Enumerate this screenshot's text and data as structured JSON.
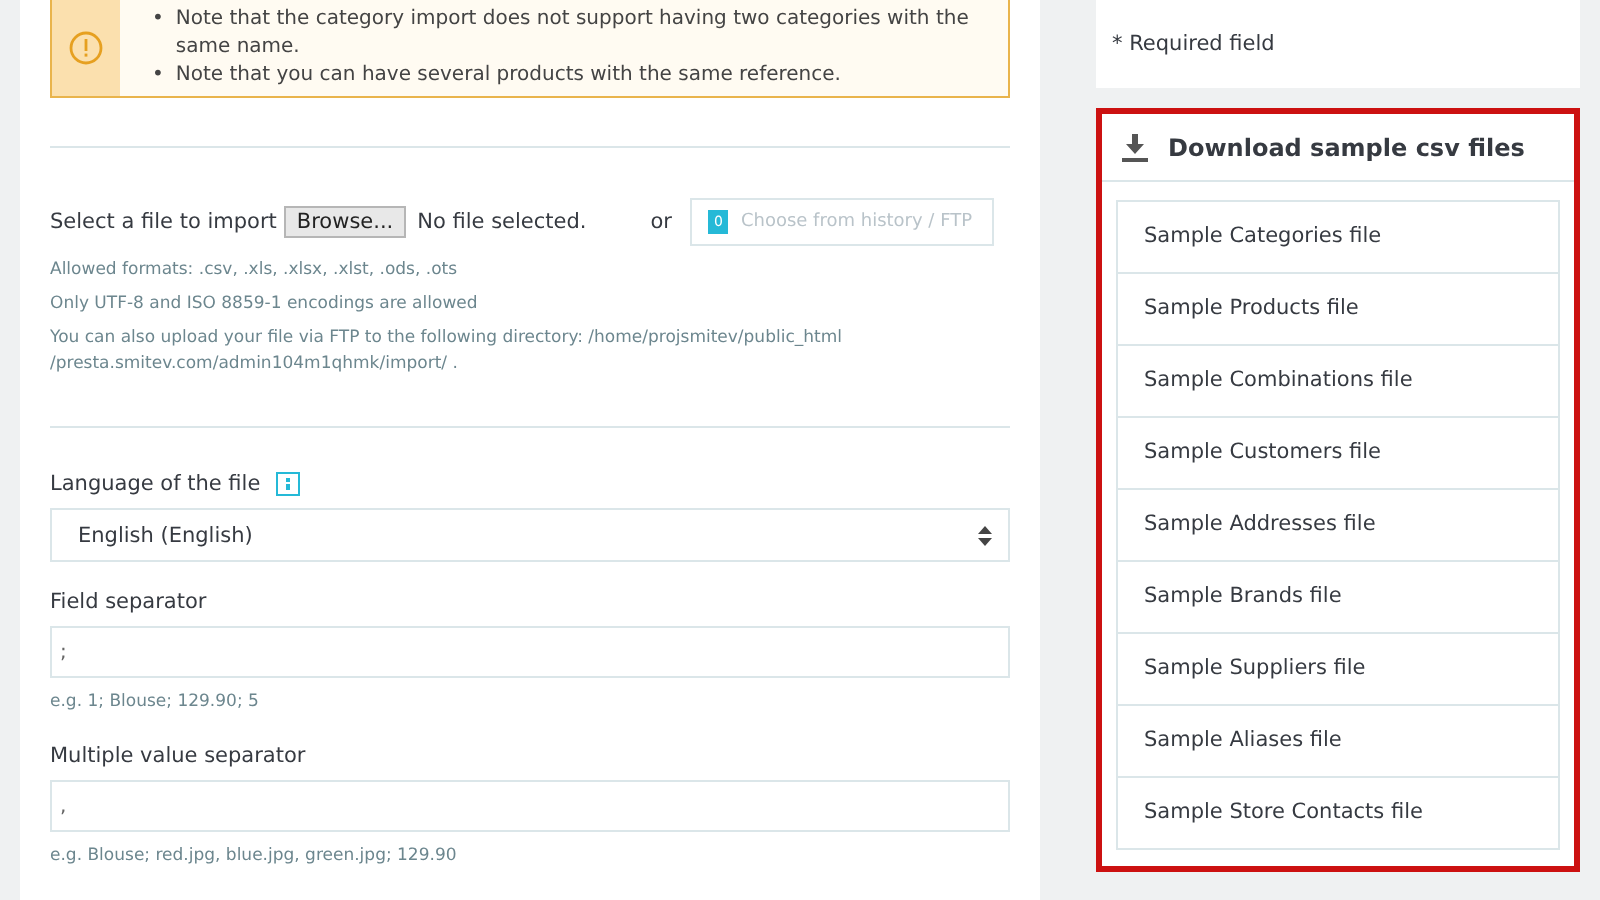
{
  "alert": {
    "items": [
      {
        "bullet": "•",
        "text": "Note that the category import does not support having two categories with the same name."
      },
      {
        "bullet": "•",
        "text": "Note that you can have several products with the same reference."
      }
    ]
  },
  "file_import": {
    "label": "Select a file to import",
    "browse_button": "Browse...",
    "file_status": "No file selected.",
    "or": "or",
    "history_count": "0",
    "history_button": "Choose from history / FTP",
    "hints": [
      "Allowed formats: .csv, .xls, .xlsx, .xlst, .ods, .ots",
      "Only UTF-8 and ISO 8859-1 encodings are allowed",
      "You can also upload your file via FTP to the following directory: /home/projsmitev/public_html /presta.smitev.com/admin104m1qhmk/import/ ."
    ]
  },
  "fields": [
    {
      "kind": "select",
      "label": "Language of the file",
      "help": true,
      "value": "English (English)"
    },
    {
      "kind": "text",
      "label": "Field separator",
      "value": ";",
      "hint": "e.g. 1; Blouse; 129.90; 5"
    },
    {
      "kind": "text",
      "label": "Multiple value separator",
      "value": ",",
      "hint": "e.g. Blouse; red.jpg, blue.jpg, green.jpg; 129.90"
    }
  ],
  "required_note": "* Required field",
  "samples": {
    "title": "Download sample csv files",
    "highlighted": true,
    "items": [
      "Sample Categories file",
      "Sample Products file",
      "Sample Combinations file",
      "Sample Customers file",
      "Sample Addresses file",
      "Sample Brands file",
      "Sample Suppliers file",
      "Sample Aliases file",
      "Sample Store Contacts file"
    ]
  }
}
